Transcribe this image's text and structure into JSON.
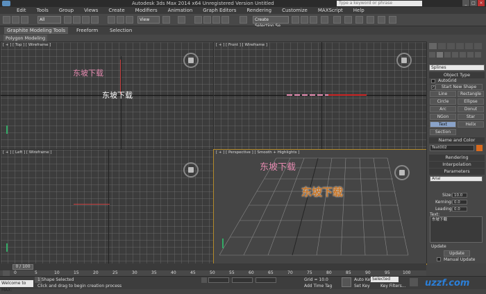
{
  "titlebar": {
    "title": "Autodesk 3ds Max  2014 x64    Unregistered Version    Untitled",
    "search_placeholder": "Type a keyword or phrase"
  },
  "menu": [
    "Edit",
    "Tools",
    "Group",
    "Views",
    "Create",
    "Modifiers",
    "Animation",
    "Graph Editors",
    "Rendering",
    "Customize",
    "MAXScript",
    "Help"
  ],
  "toolbar": {
    "selection_filter": "All",
    "reference_coord": "View",
    "named_selection": "Create Selection Se"
  },
  "ribbon": {
    "tabs": [
      "Graphite Modeling Tools",
      "Freeform",
      "Selection"
    ],
    "panel": "Polygon Modeling"
  },
  "viewports": {
    "top": {
      "label": "[ + ] [ Top ] [ Wireframe ]",
      "overlay_text": "东坡下载",
      "text": "东坡下载"
    },
    "front": {
      "label": "[ + ] [ Front ] [ Wireframe ]"
    },
    "left": {
      "label": "[ + ] [ Left ] [ Wireframe ]"
    },
    "perspective": {
      "label": "[ + ] [ Perspective ] [ Smooth + Highlights ]",
      "overlay_text": "东坡下载",
      "text": "东坡下载"
    }
  },
  "command_panel": {
    "category": "Splines",
    "rollout_object_type": "Object Type",
    "autogrid": "AutoGrid",
    "start_new_shape": "Start New Shape",
    "buttons": [
      "Line",
      "Rectangle",
      "Circle",
      "Ellipse",
      "Arc",
      "Donut",
      "NGon",
      "Star",
      "Text",
      "Helix",
      "Section"
    ],
    "rollout_name_color": "Name and Color",
    "object_name": "Text002",
    "rollout_rendering": "Rendering",
    "rollout_interpolation": "Interpolation",
    "rollout_parameters": "Parameters",
    "font": "Arial",
    "size_label": "Size:",
    "size_value": "10.0",
    "kerning_label": "Kerning:",
    "kerning_value": "0.0",
    "leading_label": "Leading:",
    "leading_value": "0.0",
    "text_label": "Text:",
    "text_value": "东坡下载",
    "update_label": "Update",
    "update_button": "Update",
    "manual_update": "Manual Update"
  },
  "timeline": {
    "frame": "0 / 100",
    "ticks": [
      "0",
      "5",
      "10",
      "15",
      "20",
      "25",
      "30",
      "35",
      "40",
      "45",
      "50",
      "55",
      "60",
      "65",
      "70",
      "75",
      "80",
      "85",
      "90",
      "95",
      "100"
    ]
  },
  "status": {
    "welcome": "Welcome to MAX:",
    "selected": "1 Shape Selected",
    "prompt": "Click and drag to begin creation process",
    "grid": "Grid = 10.0",
    "add_time_tag": "Add Time Tag",
    "auto_key": "Auto Key",
    "key_mode": "Selected",
    "set_key": "Set Key",
    "key_filters": "Key Filters...",
    "watermark": "uzzf.com"
  },
  "colors": {
    "pink_text": "#e58ab0",
    "orange_text": "#c8772a",
    "swatch": "#d86a1e"
  }
}
